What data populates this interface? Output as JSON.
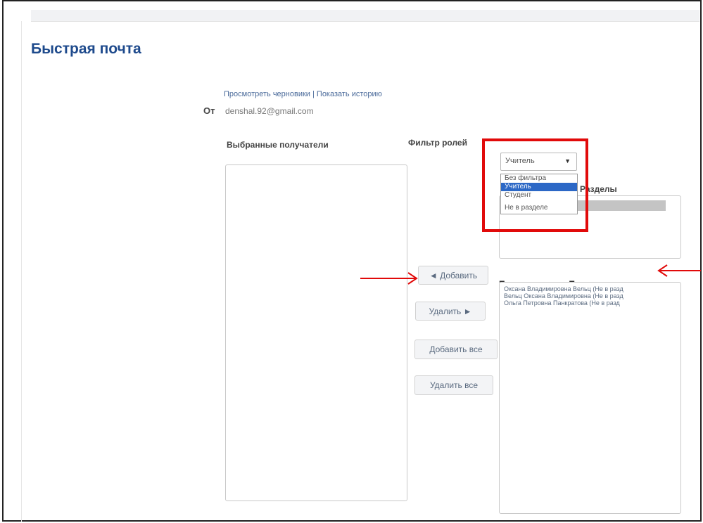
{
  "page_title": "Быстрая почта",
  "links": {
    "drafts": "Просмотреть черновики",
    "separator": " | ",
    "history": "Показать историю"
  },
  "from": {
    "label": "От",
    "value": "denshal.92@gmail.com"
  },
  "headers": {
    "selected_recipients": "Выбранные получатели",
    "role_filter": "Фильтр ролей",
    "sections": "Разделы",
    "potential_recipients": "Потенциальные Получатели"
  },
  "role_select": {
    "value": "Учитель",
    "options": [
      "Без фильтра",
      "Учитель",
      "Студент",
      "Не в разделе"
    ],
    "selected_index": 1
  },
  "potential_recipients": [
    "Оксана Владимировна Вельц (Не в разд",
    "Вельц Оксана Владимировна (Не в разд",
    "Ольга Петровна Панкратова (Не в разд"
  ],
  "buttons": {
    "add": "◄ Добавить",
    "remove": "Удалить ►",
    "add_all": "Добавить все",
    "remove_all": "Удалить все"
  },
  "annotation_color": "#e10a0a"
}
